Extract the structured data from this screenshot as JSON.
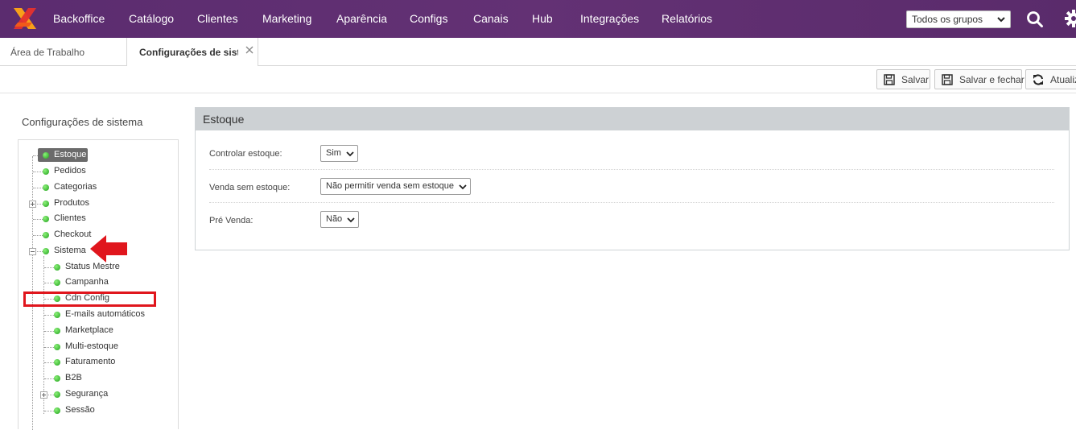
{
  "nav": {
    "items": [
      "Backoffice",
      "Catálogo",
      "Clientes",
      "Marketing",
      "Aparência",
      "Configs",
      "Canais",
      "Hub",
      "Integrações",
      "Relatórios"
    ],
    "group_select": "Todos os grupos",
    "brand_color": "#5b2c6f"
  },
  "tabs": {
    "home": "Área de Trabalho",
    "active": "Configurações de sistema"
  },
  "toolbar": {
    "save": "Salvar",
    "save_close": "Salvar e fechar",
    "update": "Atualizar"
  },
  "sidebar": {
    "title": "Configurações de sistema",
    "items": [
      {
        "label": "Estoque"
      },
      {
        "label": "Pedidos"
      },
      {
        "label": "Categorias"
      },
      {
        "label": "Produtos"
      },
      {
        "label": "Clientes"
      },
      {
        "label": "Checkout"
      },
      {
        "label": "Sistema"
      },
      {
        "label": "Status Mestre"
      },
      {
        "label": "Campanha"
      },
      {
        "label": "Cdn Config"
      },
      {
        "label": "E-mails automáticos"
      },
      {
        "label": "Marketplace"
      },
      {
        "label": "Multi-estoque"
      },
      {
        "label": "Faturamento"
      },
      {
        "label": "B2B"
      },
      {
        "label": "Segurança"
      },
      {
        "label": "Sessão"
      }
    ]
  },
  "panel": {
    "title": "Estoque",
    "fields": [
      {
        "label": "Controlar estoque:",
        "value": "Sim"
      },
      {
        "label": "Venda sem estoque:",
        "value": "Não permitir venda sem estoque"
      },
      {
        "label": "Pré Venda:",
        "value": "Não"
      }
    ]
  }
}
